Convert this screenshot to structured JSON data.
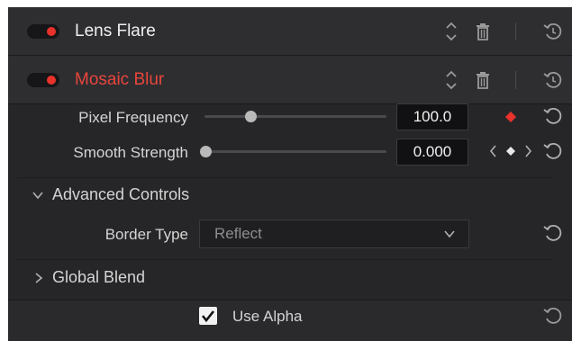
{
  "effects": [
    {
      "name": "Lens Flare",
      "enabled": true
    },
    {
      "name": "Mosaic Blur",
      "enabled": true
    }
  ],
  "params": {
    "pixel_frequency": {
      "label": "Pixel Frequency",
      "value": "100.0",
      "slider_fraction": 0.25
    },
    "smooth_strength": {
      "label": "Smooth Strength",
      "value": "0.000",
      "slider_fraction": 0.0
    }
  },
  "advanced": {
    "title": "Advanced Controls",
    "border_type_label": "Border Type",
    "border_type_value": "Reflect"
  },
  "global_blend": {
    "title": "Global Blend"
  },
  "use_alpha": {
    "label": "Use Alpha",
    "checked": true
  },
  "colors": {
    "accent_red": "#e8322a",
    "title_red": "#e8453c",
    "panel_bg": "#262629"
  },
  "icons": {
    "toggle": "enable-toggle",
    "updown": "updown-chevrons-icon",
    "trash": "trash-icon",
    "reset": "reset-icon",
    "keyframe": "keyframe-diamond-icon",
    "nav_keyframes": "keyframe-nav-icon",
    "chevron_down": "chevron-down-icon",
    "chevron_right": "chevron-right-icon",
    "checkmark": "checkmark-icon"
  }
}
